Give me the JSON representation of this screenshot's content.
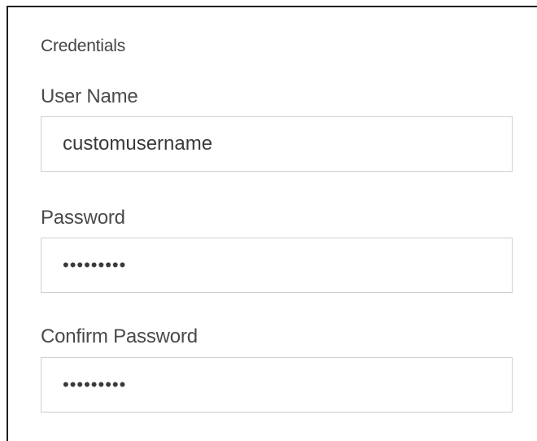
{
  "credentials": {
    "section_title": "Credentials",
    "username": {
      "label": "User Name",
      "value": "customusername"
    },
    "password": {
      "label": "Password",
      "value": "•••••••••"
    },
    "confirm_password": {
      "label": "Confirm Password",
      "value": "•••••••••"
    }
  }
}
